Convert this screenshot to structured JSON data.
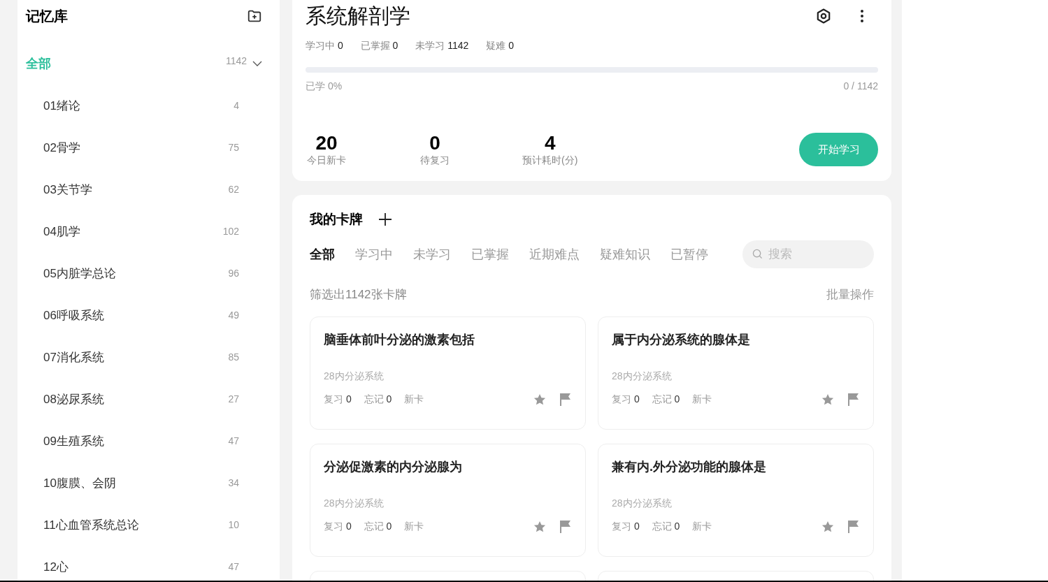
{
  "sidebar": {
    "title": "记忆库",
    "all": {
      "label": "全部",
      "count": "1142",
      "selected": true,
      "expanded": true
    },
    "items": [
      {
        "label": "01绪论",
        "count": "4"
      },
      {
        "label": "02骨学",
        "count": "75"
      },
      {
        "label": "03关节学",
        "count": "62"
      },
      {
        "label": "04肌学",
        "count": "102"
      },
      {
        "label": "05内脏学总论",
        "count": "96"
      },
      {
        "label": "06呼吸系统",
        "count": "49"
      },
      {
        "label": "07消化系统",
        "count": "85"
      },
      {
        "label": "08泌尿系统",
        "count": "27"
      },
      {
        "label": "09生殖系统",
        "count": "47"
      },
      {
        "label": "10腹膜、会阴",
        "count": "34"
      },
      {
        "label": "11心血管系统总论",
        "count": "10"
      },
      {
        "label": "12心",
        "count": "47"
      }
    ]
  },
  "deck": {
    "title": "系统解剖学",
    "stats": [
      {
        "label": "学习中",
        "value": "0"
      },
      {
        "label": "已掌握",
        "value": "0"
      },
      {
        "label": "未学习",
        "value": "1142"
      },
      {
        "label": "疑难",
        "value": "0"
      }
    ],
    "progress": {
      "level": 0,
      "label": "已学 0%",
      "reading": "0 / 1142"
    },
    "today": [
      {
        "value": "20",
        "label": "今日新卡"
      },
      {
        "value": "0",
        "label": "待复习"
      },
      {
        "value": "4",
        "label": "预计耗时(分)"
      }
    ],
    "start_button": "开始学习"
  },
  "cards_panel": {
    "title": "我的卡牌",
    "tabs": [
      {
        "label": "全部",
        "selected": true
      },
      {
        "label": "学习中",
        "selected": false
      },
      {
        "label": "未学习",
        "selected": false
      },
      {
        "label": "已掌握",
        "selected": false
      },
      {
        "label": "近期难点",
        "selected": false
      },
      {
        "label": "疑难知识",
        "selected": false
      },
      {
        "label": "已暂停",
        "selected": false
      }
    ],
    "search": {
      "placeholder": "搜索"
    },
    "filter_summary": "筛选出1142张卡牌",
    "batch": "批量操作",
    "cards": [
      {
        "question": "脑垂体前叶分泌的激素包括",
        "chapter": "28内分泌系统",
        "review_label": "复习",
        "review": "0",
        "forget_label": "忘记",
        "forget": "0",
        "status": "新卡"
      },
      {
        "question": "属于内分泌系统的腺体是",
        "chapter": "28内分泌系统",
        "review_label": "复习",
        "review": "0",
        "forget_label": "忘记",
        "forget": "0",
        "status": "新卡"
      },
      {
        "question": "分泌促激素的内分泌腺为",
        "chapter": "28内分泌系统",
        "review_label": "复习",
        "review": "0",
        "forget_label": "忘记",
        "forget": "0",
        "status": "新卡"
      },
      {
        "question": "兼有内.外分泌功能的腺体是",
        "chapter": "28内分泌系统",
        "review_label": "复习",
        "review": "0",
        "forget_label": "忘记",
        "forget": "0",
        "status": "新卡"
      }
    ]
  }
}
